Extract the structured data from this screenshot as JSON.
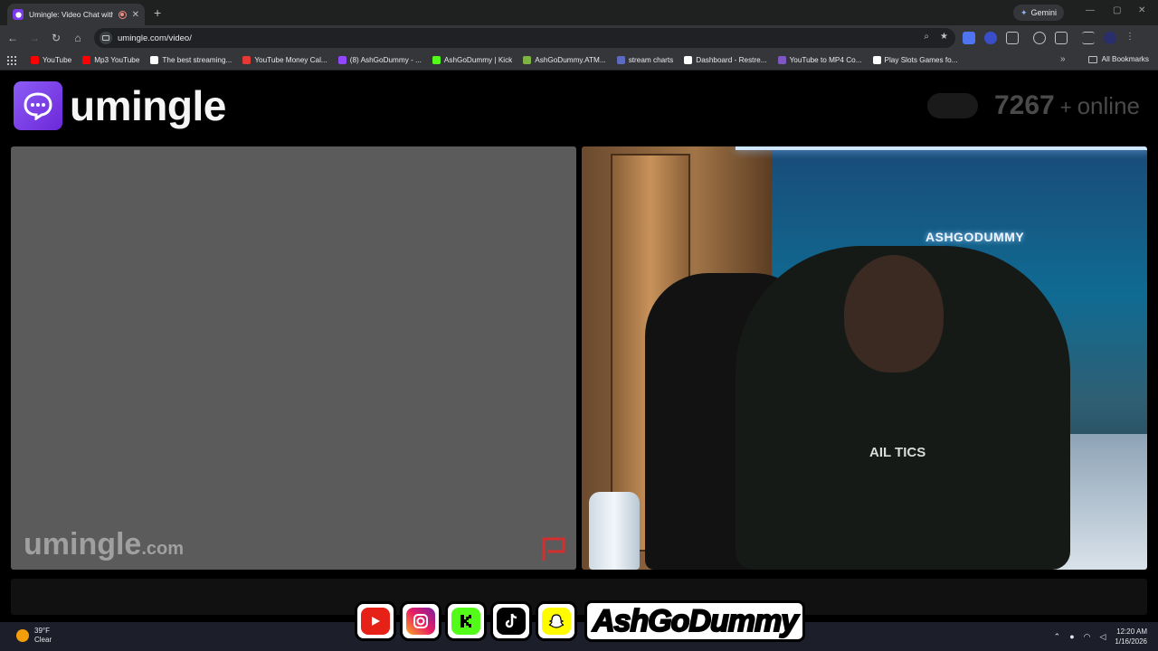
{
  "browser": {
    "tab_title": "Umingle: Video Chat with S",
    "gemini_label": "Gemini",
    "url": "umingle.com/video/",
    "bookmarks": [
      {
        "label": "YouTube",
        "color": "#ff0000"
      },
      {
        "label": "Mp3 YouTube",
        "color": "#ff0000"
      },
      {
        "label": "The best streaming...",
        "color": "#ffffff"
      },
      {
        "label": "YouTube Money Cal...",
        "color": "#e53935"
      },
      {
        "label": "(8) AshGoDummy - ...",
        "color": "#9146ff"
      },
      {
        "label": "AshGoDummy | Kick",
        "color": "#53fc18"
      },
      {
        "label": "AshGoDummy.ATM...",
        "color": "#7cb342"
      },
      {
        "label": "stream charts",
        "color": "#5c6bc0"
      },
      {
        "label": "Dashboard - Restre...",
        "color": "#ffffff"
      },
      {
        "label": "YouTube to MP4 Co...",
        "color": "#7e57c2"
      },
      {
        "label": "Play Slots Games fo...",
        "color": "#ffffff"
      }
    ],
    "all_bookmarks": "All Bookmarks"
  },
  "site": {
    "logo_text": "umingle",
    "online_count": "7267",
    "online_plus": "+",
    "online_label": "online",
    "watermark_main": "umingle",
    "watermark_suffix": ".com",
    "brand_color": "#7c3aed"
  },
  "video": {
    "handle": "ASHGODUMMY",
    "shirt_text": "AIL TICS"
  },
  "taskbar": {
    "temp": "39°F",
    "condition": "Clear",
    "time": "12:20 AM",
    "date": "1/16/2026"
  },
  "overlay": {
    "name": "AshGoDummy",
    "icons": [
      "youtube-icon",
      "instagram-icon",
      "kick-icon",
      "tiktok-icon",
      "snapchat-icon"
    ]
  }
}
